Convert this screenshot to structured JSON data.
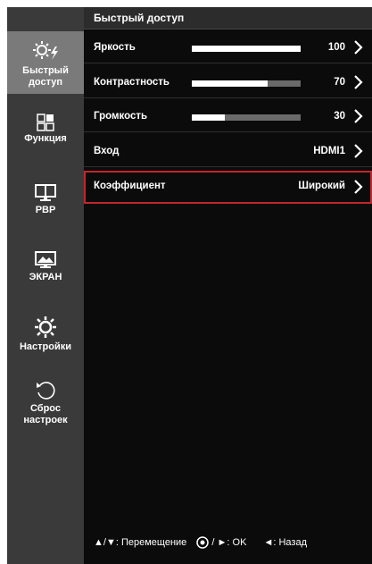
{
  "sidebar": {
    "items": [
      {
        "label": "Быстрый доступ",
        "icon": "quick-settings-icon"
      },
      {
        "label": "Функция",
        "icon": "function-icon"
      },
      {
        "label": "PBP",
        "icon": "pbp-icon"
      },
      {
        "label": "ЭКРАН",
        "icon": "picture-icon"
      },
      {
        "label": "Настройки",
        "icon": "settings-icon"
      },
      {
        "label": "Сброс настроек",
        "icon": "reset-icon"
      }
    ]
  },
  "header": {
    "title": "Быстрый доступ"
  },
  "rows": [
    {
      "label": "Яркость",
      "value": "100",
      "level": 1.0
    },
    {
      "label": "Контрастность",
      "value": "70",
      "level": 0.7
    },
    {
      "label": "Громкость",
      "value": "30",
      "level": 0.3
    },
    {
      "label": "Вход",
      "value": "HDMI1"
    },
    {
      "label": "Коэффициент",
      "value": "Широкий"
    }
  ],
  "footer": {
    "move_keys": "▲/▼",
    "move_label": ": Перемещение",
    "ok_keys": "/ ►",
    "ok_label": ": OK",
    "back_key": "◄",
    "back_label": ": Назад"
  },
  "colors": {
    "selection_outline": "#c1272d",
    "active_tab": "#7a7a7a",
    "sidebar": "#3a3a3a"
  }
}
